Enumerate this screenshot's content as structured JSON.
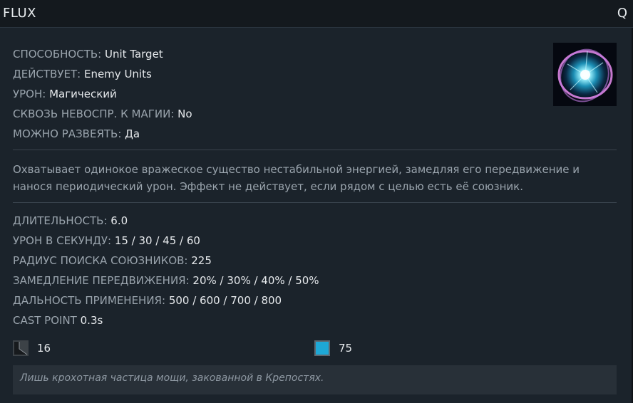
{
  "ability": {
    "name": "FLUX",
    "hotkey": "Q",
    "icon": "flux-orb-icon"
  },
  "attributes": [
    {
      "label": "СПОСОБНОСТЬ:",
      "value": "Unit Target"
    },
    {
      "label": "ДЕЙСТВУЕТ:",
      "value": "Enemy Units"
    },
    {
      "label": "УРОН:",
      "value": "Магический"
    },
    {
      "label": "СКВОЗЬ НЕВОСПР. К МАГИИ:",
      "value": "No"
    },
    {
      "label": "МОЖНО РАЗВЕЯТЬ:",
      "value": "Да"
    }
  ],
  "description": "Охватывает одинокое вражеское существо нестабильной энергией, замедляя его передвижение и нанося периодический урон. Эффект не действует, если рядом с целью есть её союзник.",
  "stats": [
    {
      "label": "ДЛИТЕЛЬНОСТЬ:",
      "value": "6.0"
    },
    {
      "label": "УРОН В СЕКУНДУ:",
      "value": "15 / 30 / 45 / 60"
    },
    {
      "label": "РАДИУС ПОИСКА СОЮЗНИКОВ:",
      "value": "225"
    },
    {
      "label": "ЗАМЕДЛЕНИЕ ПЕРЕДВИЖЕНИЯ:",
      "value": "20% / 30% / 40% / 50%"
    },
    {
      "label": "ДАЛЬНОСТЬ ПРИМЕНЕНИЯ:",
      "value": "500 / 600 / 700 / 800"
    },
    {
      "label": "CAST POINT",
      "value": "0.3s"
    }
  ],
  "cooldown": {
    "icon": "cooldown-icon",
    "value": "16"
  },
  "mana": {
    "icon": "mana-icon",
    "value": "75",
    "color": "#1ea8d6"
  },
  "lore": "Лишь крохотная частица мощи, закованной в Крепостях."
}
